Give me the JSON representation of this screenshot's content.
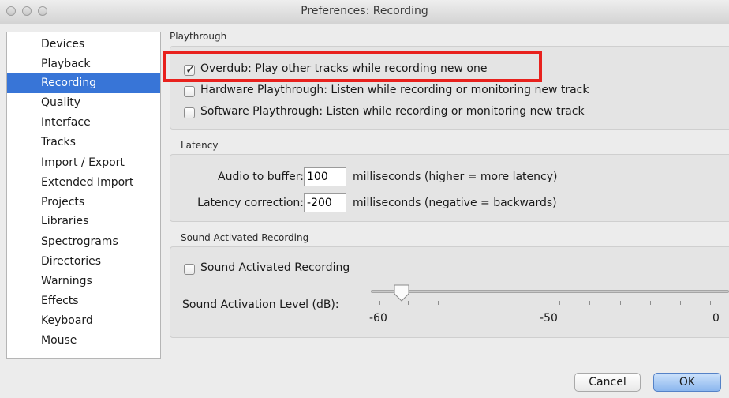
{
  "window": {
    "title": "Preferences: Recording"
  },
  "sidebar": {
    "items": [
      {
        "label": "Devices"
      },
      {
        "label": "Playback"
      },
      {
        "label": "Recording",
        "selected": true
      },
      {
        "label": "Quality"
      },
      {
        "label": "Interface"
      },
      {
        "label": "Tracks"
      },
      {
        "label": "Import / Export"
      },
      {
        "label": "Extended Import"
      },
      {
        "label": "Projects"
      },
      {
        "label": "Libraries"
      },
      {
        "label": "Spectrograms"
      },
      {
        "label": "Directories"
      },
      {
        "label": "Warnings"
      },
      {
        "label": "Effects"
      },
      {
        "label": "Keyboard"
      },
      {
        "label": "Mouse"
      }
    ],
    "selected_color": "#3875d7"
  },
  "playthrough": {
    "heading": "Playthrough",
    "overdub": {
      "label": "Overdub: Play other tracks while recording new one",
      "checked": true
    },
    "hardware": {
      "label": "Hardware Playthrough: Listen while recording or monitoring new track",
      "checked": false
    },
    "software": {
      "label": "Software Playthrough: Listen while recording or monitoring new track",
      "checked": false
    },
    "highlight_color": "#e8211d"
  },
  "latency": {
    "heading": "Latency",
    "buffer": {
      "label": "Audio to buffer:",
      "value": "100",
      "units": "milliseconds (higher = more latency)"
    },
    "correction": {
      "label": "Latency correction:",
      "value": "-200",
      "units": "milliseconds (negative = backwards)"
    }
  },
  "sound_activated": {
    "heading": "Sound Activated Recording",
    "checkbox": {
      "label": "Sound Activated Recording",
      "checked": false
    },
    "level": {
      "label": "Sound Activation Level (dB):",
      "value_db": -55,
      "min_db": -60,
      "max_db": 0,
      "tick_labels": [
        "-60",
        "-50",
        "0"
      ]
    }
  },
  "buttons": {
    "cancel": "Cancel",
    "ok": "OK"
  },
  "icons": {
    "checkmark": "✓",
    "close": "close-icon",
    "minimize": "minimize-icon",
    "zoom": "zoom-icon"
  }
}
